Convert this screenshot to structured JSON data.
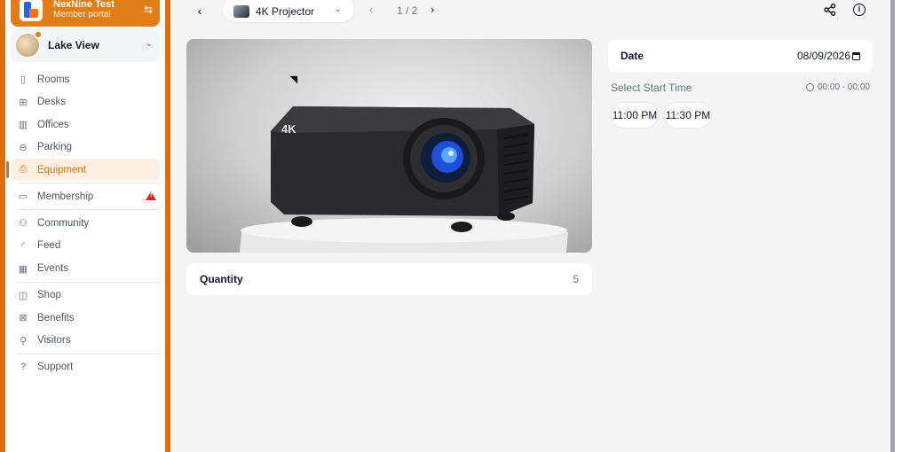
{
  "org": {
    "name": "NexNine Test",
    "subtitle": "Member portal"
  },
  "location": {
    "name": "Lake View"
  },
  "nav": {
    "rooms": "Rooms",
    "desks": "Desks",
    "offices": "Offices",
    "parking": "Parking",
    "equipment": "Equipment",
    "membership": "Membership",
    "community": "Community",
    "feed": "Feed",
    "events": "Events",
    "shop": "Shop",
    "benefits": "Benefits",
    "visitors": "Visitors",
    "support": "Support",
    "active": "Equipment"
  },
  "topbar": {
    "selected_item": "4K Projector",
    "pager": "1 / 2"
  },
  "item": {
    "image_badge": "4K",
    "quantity_label": "Quantity",
    "quantity_value": "5"
  },
  "booking": {
    "date_label": "Date",
    "date_value": "08/09/2026",
    "start_title": "Select Start Time",
    "time_range": "00:00 - 00:00",
    "slots": [
      "11:00 PM",
      "11:30 PM"
    ]
  },
  "colors": {
    "accent": "#d96f0f",
    "warning": "#dc2626"
  },
  "icons": {
    "back": "chevron-left-icon",
    "share": "share-icon",
    "info": "info-icon",
    "switch": "switch-icon"
  }
}
